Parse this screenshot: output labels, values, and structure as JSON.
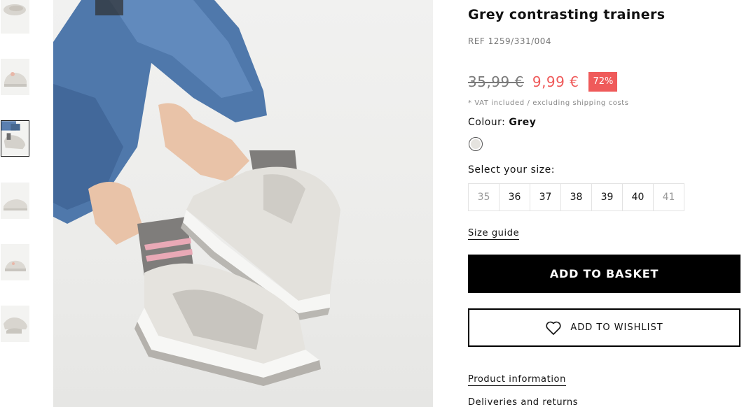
{
  "thumbnails": [
    {
      "label": "thumbnail-1",
      "active": false
    },
    {
      "label": "thumbnail-2",
      "active": false
    },
    {
      "label": "thumbnail-3",
      "active": true
    },
    {
      "label": "thumbnail-4",
      "active": false
    },
    {
      "label": "thumbnail-5",
      "active": false
    },
    {
      "label": "thumbnail-6",
      "active": false
    }
  ],
  "product": {
    "title": "Grey contrasting trainers",
    "ref": "REF 1259/331/004",
    "old_price": "35,99 €",
    "new_price": "9,99 €",
    "discount": "72%",
    "vat_note": "* VAT included / excluding shipping costs",
    "colour_label": "Colour:",
    "colour_value": "Grey",
    "size_label": "Select your size:",
    "sizes": [
      {
        "label": "35",
        "available": false
      },
      {
        "label": "36",
        "available": true
      },
      {
        "label": "37",
        "available": true
      },
      {
        "label": "38",
        "available": true
      },
      {
        "label": "39",
        "available": true
      },
      {
        "label": "40",
        "available": true
      },
      {
        "label": "41",
        "available": false
      }
    ],
    "size_guide": "Size guide",
    "add_to_basket": "ADD TO BASKET",
    "add_to_wishlist": "ADD TO WISHLIST",
    "product_information": "Product information",
    "deliveries_returns": "Deliveries and returns"
  },
  "colors": {
    "sale": "#ef5a5a",
    "primary": "#000000",
    "swatch_grey": "#e5e3df"
  },
  "icons": {
    "wishlist": "heart-icon"
  }
}
